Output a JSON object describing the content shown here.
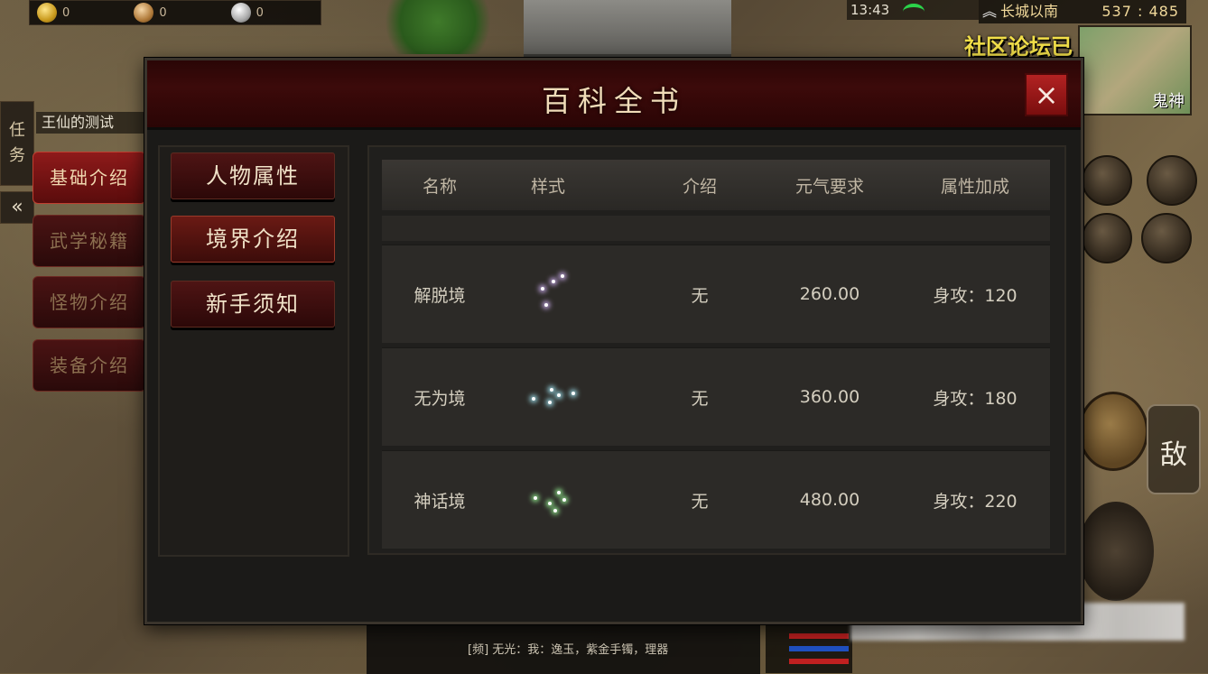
{
  "hud": {
    "currency": [
      {
        "icon": "gold-ingot-icon",
        "value": "0"
      },
      {
        "icon": "copper-coin-icon",
        "value": "0"
      },
      {
        "icon": "silver-coin-icon",
        "value": "0"
      }
    ],
    "time": "13:43",
    "location_name": "长城以南",
    "coords": "537 : 485",
    "forum_text": "社区论坛已",
    "minimap_label": "鬼神",
    "task_tab": [
      "任",
      "务"
    ],
    "collapse_label": "«",
    "quest_title": "王仙的测试",
    "side_buttons": [
      "基础介绍",
      "武学秘籍",
      "怪物介绍",
      "装备介绍"
    ],
    "enemy_button": "敌",
    "chat_line": "[频] 无光：我：逸玉，紫金手镯，理器"
  },
  "dialog": {
    "title": "百科全书",
    "close_label": "×",
    "categories": [
      "人物属性",
      "境界介绍",
      "新手须知"
    ],
    "columns": [
      "名称",
      "样式",
      "介绍",
      "元气要求",
      "属性加成"
    ],
    "rows": [
      {
        "name": "解脱境",
        "desc": "无",
        "requirement": "260.00",
        "bonus": "身攻：120",
        "spark_color": "#d9b8ff"
      },
      {
        "name": "无为境",
        "desc": "无",
        "requirement": "360.00",
        "bonus": "身攻：180",
        "spark_color": "#a8f0ff"
      },
      {
        "name": "神话境",
        "desc": "无",
        "requirement": "480.00",
        "bonus": "身攻：220",
        "spark_color": "#9dff9a"
      }
    ]
  },
  "colors": {
    "dialog_header": "#3c0a0a",
    "close_button": "#b22222",
    "active_side_button": "#8e1a1a",
    "forum_text": "#f3e04a"
  }
}
